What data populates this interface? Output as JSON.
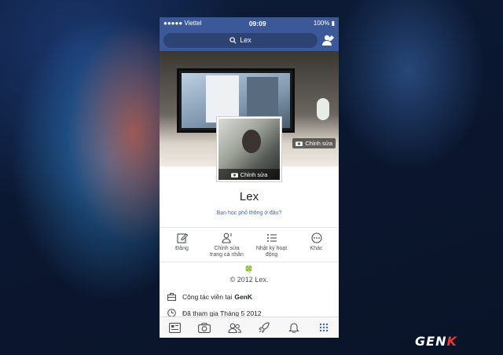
{
  "status": {
    "carrier": "●●●●● Viettel",
    "time": "09:09",
    "battery": "100%"
  },
  "search": {
    "query": "Lex"
  },
  "cover": {
    "edit_label": "Chỉnh sửa"
  },
  "avatar": {
    "edit_label": "Chỉnh sửa"
  },
  "profile": {
    "name": "Lex",
    "hint": "Bạn học phổ thông ở đâu?"
  },
  "actions": [
    {
      "icon": "pencil-icon",
      "label": "Đăng"
    },
    {
      "icon": "edit-profile-icon",
      "label_line1": "Chỉnh sửa",
      "label_line2": "trang cá nhân"
    },
    {
      "icon": "list-icon",
      "label_line1": "Nhật ký hoạt",
      "label_line2": "động"
    },
    {
      "icon": "more-icon",
      "label": "Khác"
    }
  ],
  "bio": {
    "clover": "🍀",
    "copyright": "© 2012 Lex."
  },
  "info": [
    {
      "icon": "briefcase-icon",
      "text": "Cộng tác viên tại",
      "bold": "GenK"
    },
    {
      "icon": "clock-icon",
      "text": "Đã tham gia Tháng 5 2012"
    }
  ],
  "tabs": [
    "news-feed-icon",
    "camera-icon",
    "friends-icon",
    "rocket-icon",
    "bell-icon",
    "menu-grid-icon"
  ],
  "watermark": {
    "text_main": "GEN",
    "text_accent": "K"
  },
  "colors": {
    "brand": "#3b5998",
    "link": "#4267b2"
  }
}
